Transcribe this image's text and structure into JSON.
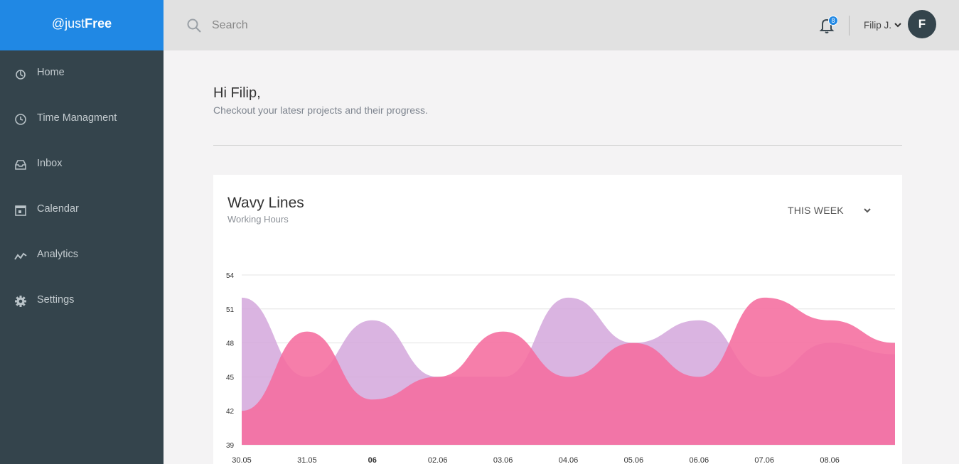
{
  "brand": {
    "prefix": "@just",
    "bold": "Free"
  },
  "sidebar": {
    "items": [
      {
        "label": "Home",
        "icon": "home-icon"
      },
      {
        "label": "Time Managment",
        "icon": "clock-icon"
      },
      {
        "label": "Inbox",
        "icon": "inbox-icon"
      },
      {
        "label": "Calendar",
        "icon": "calendar-icon"
      },
      {
        "label": "Analytics",
        "icon": "analytics-icon"
      },
      {
        "label": "Settings",
        "icon": "gear-icon"
      }
    ]
  },
  "topbar": {
    "search_placeholder": "Search",
    "notification_count": "8",
    "user_name": "Filip J.",
    "avatar_initial": "F"
  },
  "main": {
    "greeting": "Hi Filip,",
    "subtitle": "Checkout your latesr projects and their progress."
  },
  "card": {
    "title": "Wavy Lines",
    "subtitle": "Working Hours",
    "period": "THIS WEEK"
  },
  "colors": {
    "accent": "#2088e4",
    "sidebar_bg": "#34444c",
    "series_purple": "#d4a7dc",
    "series_pink": "#f56c9e"
  },
  "chart_data": {
    "type": "area",
    "x": [
      "30.05",
      "31.05",
      "06",
      "02.06",
      "03.06",
      "04.06",
      "05.06",
      "06.06",
      "07.06",
      "08.06",
      ""
    ],
    "ylim": [
      39,
      54
    ],
    "yticks": [
      39,
      42,
      45,
      48,
      51,
      54
    ],
    "grid": true,
    "series": [
      {
        "color": "#d4a7dc",
        "values": [
          52,
          45,
          50,
          45,
          45,
          52,
          48,
          50,
          45,
          48,
          47
        ]
      },
      {
        "color": "#f56c9e",
        "values": [
          42,
          49,
          43,
          45,
          49,
          45,
          48,
          45,
          52,
          50,
          48
        ]
      }
    ]
  }
}
